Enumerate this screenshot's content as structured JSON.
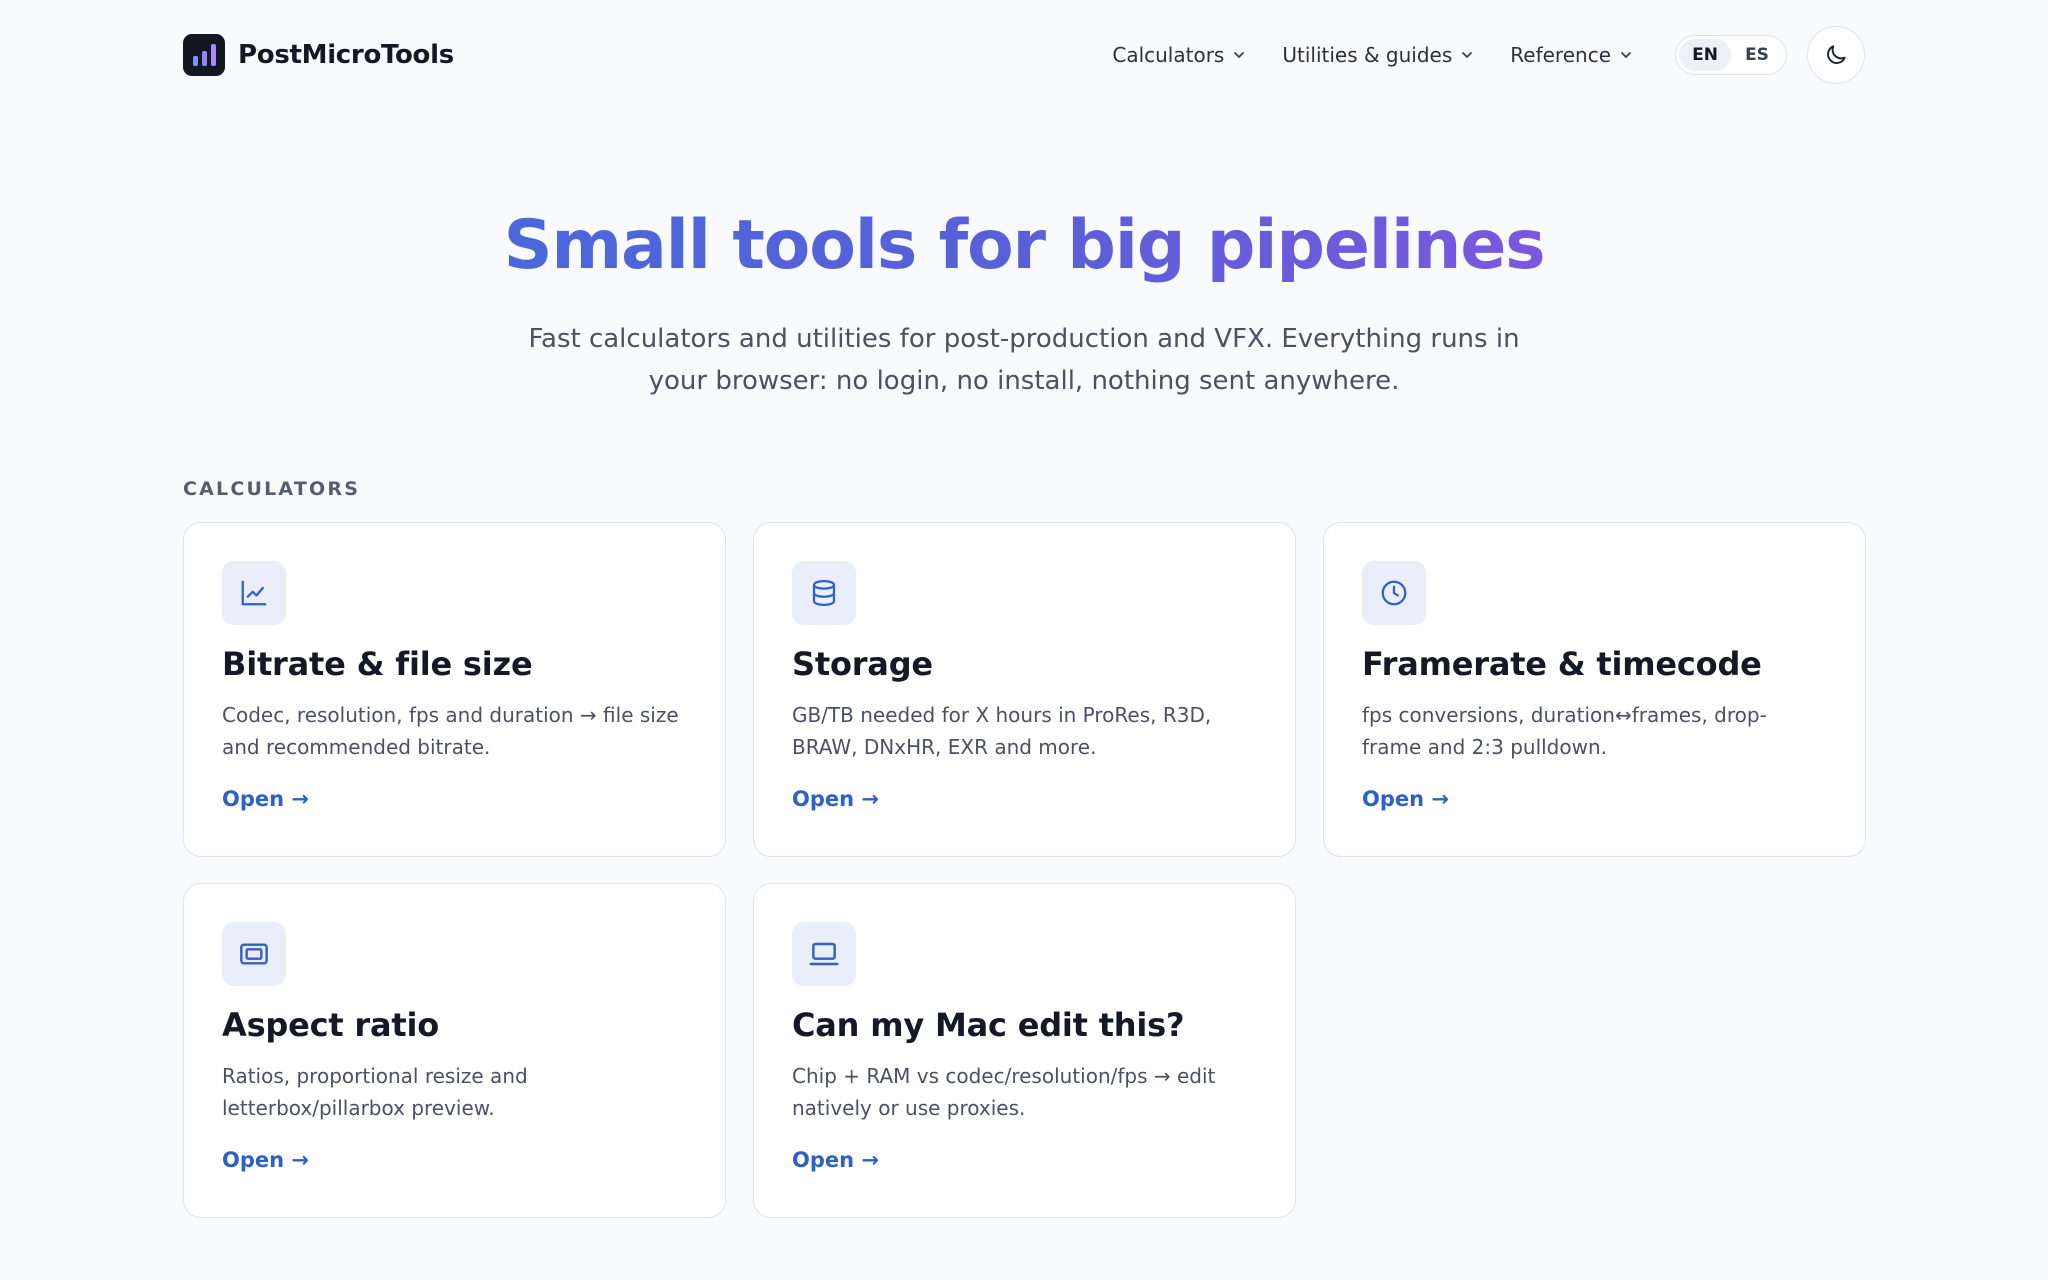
{
  "brand": {
    "name": "PostMicroTools"
  },
  "nav": {
    "items": [
      {
        "label": "Calculators"
      },
      {
        "label": "Utilities & guides"
      },
      {
        "label": "Reference"
      }
    ],
    "lang": {
      "en": "EN",
      "es": "ES",
      "active": "EN"
    }
  },
  "hero": {
    "title": "Small tools for big pipelines",
    "subtitle": "Fast calculators and utilities for post-production and VFX. Everything runs in your browser: no login, no install, nothing sent anywhere."
  },
  "section": {
    "label": "CALCULATORS"
  },
  "cards": [
    {
      "icon": "chart-line-icon",
      "title": "Bitrate & file size",
      "desc": "Codec, resolution, fps and duration → file size and recommended bitrate.",
      "link": "Open →"
    },
    {
      "icon": "database-icon",
      "title": "Storage",
      "desc": "GB/TB needed for X hours in ProRes, R3D, BRAW, DNxHR, EXR and more.",
      "link": "Open →"
    },
    {
      "icon": "clock-icon",
      "title": "Framerate & timecode",
      "desc": "fps conversions, duration↔frames, drop-frame and 2:3 pulldown.",
      "link": "Open →"
    },
    {
      "icon": "aspect-ratio-icon",
      "title": "Aspect ratio",
      "desc": "Ratios, proportional resize and letterbox/pillarbox preview.",
      "link": "Open →"
    },
    {
      "icon": "laptop-icon",
      "title": "Can my Mac edit this?",
      "desc": "Chip + RAM vs codec/resolution/fps → edit natively or use proxies.",
      "link": "Open →"
    }
  ],
  "colors": {
    "accent": "#2f60c6",
    "gradient_start": "#4a68db",
    "gradient_end": "#7a58de",
    "icon_bg": "#eaeefb"
  }
}
